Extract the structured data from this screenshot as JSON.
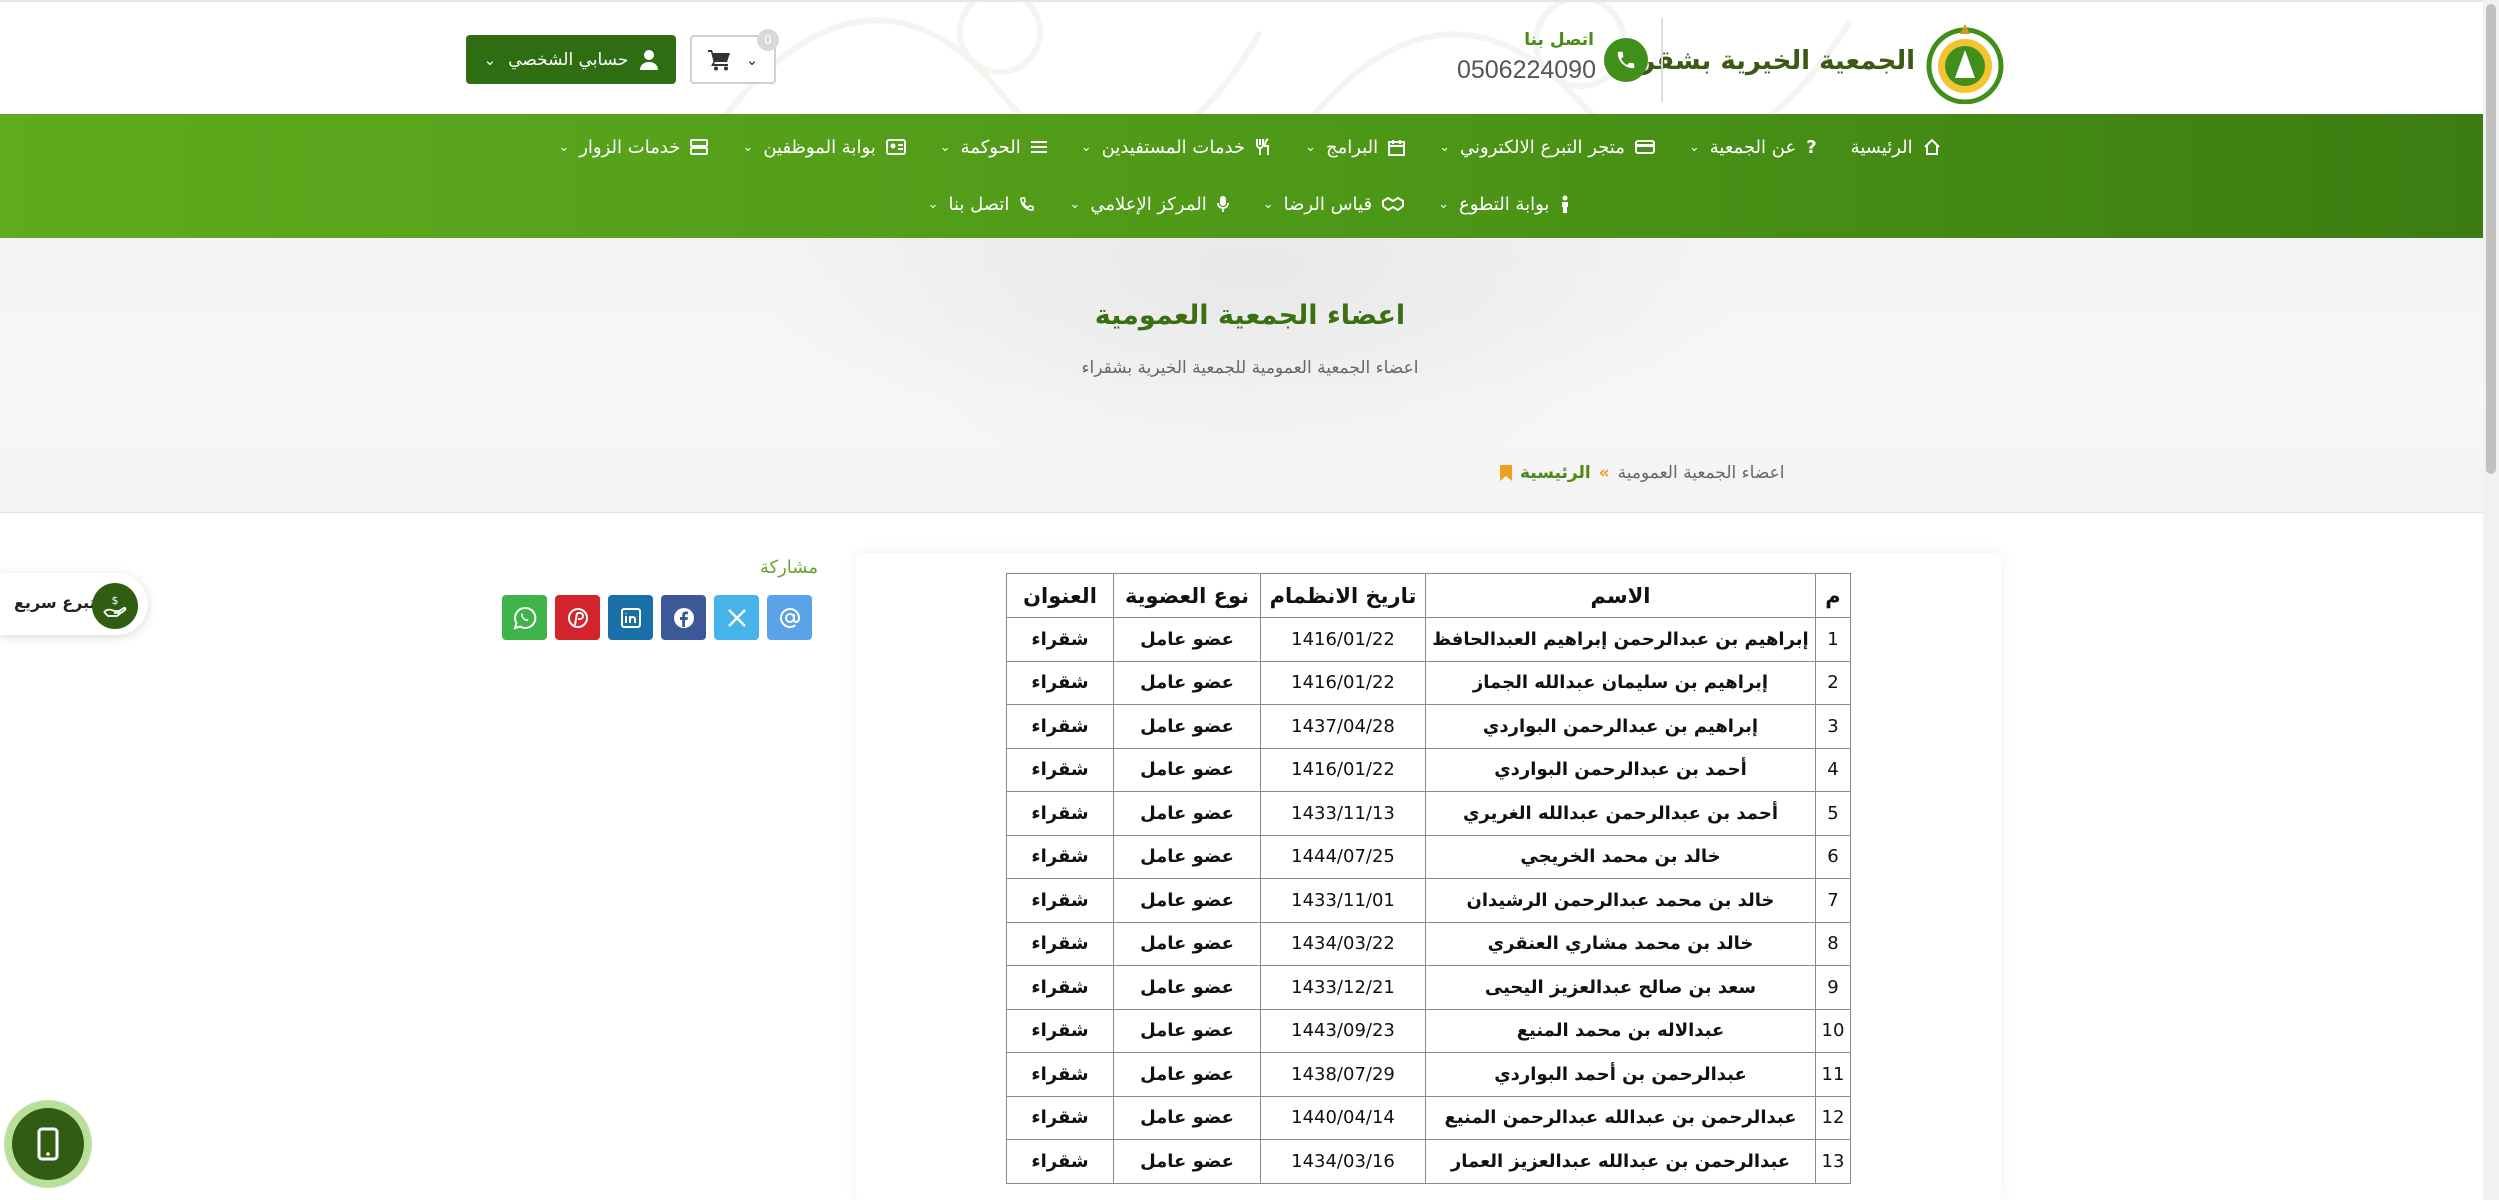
{
  "header": {
    "org_name": "الجمعية الخيرية بشقراء",
    "contact_label": "اتصل بنا",
    "contact_phone": "0506224090",
    "account_label": "حسابي الشخصي",
    "cart_count": "0"
  },
  "nav": {
    "row1": [
      {
        "label": "الرئيسية",
        "icon": "home-icon",
        "has_menu": false
      },
      {
        "label": "عن الجمعية",
        "icon": "question-icon",
        "has_menu": true
      },
      {
        "label": "متجر التبرع الالكتروني",
        "icon": "credit-card-icon",
        "has_menu": true
      },
      {
        "label": "البرامج",
        "icon": "calendar-icon",
        "has_menu": true
      },
      {
        "label": "خدمات المستفيدين",
        "icon": "utensils-icon",
        "has_menu": true
      },
      {
        "label": "الحوكمة",
        "icon": "list-icon",
        "has_menu": true
      },
      {
        "label": "بوابة الموظفين",
        "icon": "id-card-icon",
        "has_menu": true
      },
      {
        "label": "خدمات الزوار",
        "icon": "server-icon",
        "has_menu": true
      }
    ],
    "row2": [
      {
        "label": "بوابة التطوع",
        "icon": "person-icon",
        "has_menu": true
      },
      {
        "label": "قياس الرضا",
        "icon": "handshake-icon",
        "has_menu": true
      },
      {
        "label": "المركز الإعلامي",
        "icon": "microphone-icon",
        "has_menu": true
      },
      {
        "label": "اتصل بنا",
        "icon": "phone-icon",
        "has_menu": true
      }
    ]
  },
  "page": {
    "title": "اعضاء الجمعية العمومية",
    "subtitle": "اعضاء الجمعية العمومية للجمعية الخيرية بشقراء"
  },
  "breadcrumb": {
    "home": "الرئيسية",
    "separator": "»",
    "current": "اعضاء الجمعية العمومية"
  },
  "table": {
    "headers": [
      "م",
      "الاسم",
      "تاريخ الانظمام",
      "نوع العضوية",
      "العنوان"
    ],
    "rows": [
      [
        "1",
        "إبراهيم بن عبدالرحمن إبراهيم العبدالحافظ",
        "1416/01/22",
        "عضو عامل",
        "شقراء"
      ],
      [
        "2",
        "إبراهيم بن سليمان عبدالله الجماز",
        "1416/01/22",
        "عضو عامل",
        "شقراء"
      ],
      [
        "3",
        "إبراهيم بن عبدالرحمن البواردي",
        "1437/04/28",
        "عضو عامل",
        "شقراء"
      ],
      [
        "4",
        "أحمد بن عبدالرحمن البواردي",
        "1416/01/22",
        "عضو عامل",
        "شقراء"
      ],
      [
        "5",
        "أحمد بن عبدالرحمن عبدالله الغريري",
        "1433/11/13",
        "عضو عامل",
        "شقراء"
      ],
      [
        "6",
        "خالد بن محمد الخريجي",
        "1444/07/25",
        "عضو عامل",
        "شقراء"
      ],
      [
        "7",
        "خالد بن محمد عبدالرحمن الرشيدان",
        "1433/11/01",
        "عضو عامل",
        "شقراء"
      ],
      [
        "8",
        "خالد بن محمد مشاري العنقري",
        "1434/03/22",
        "عضو عامل",
        "شقراء"
      ],
      [
        "9",
        "سعد بن صالح عبدالعزيز اليحيى",
        "1433/12/21",
        "عضو عامل",
        "شقراء"
      ],
      [
        "10",
        "عبدالاله بن محمد المنيع",
        "1443/09/23",
        "عضو عامل",
        "شقراء"
      ],
      [
        "11",
        "عبدالرحمن بن أحمد البواردي",
        "1438/07/29",
        "عضو عامل",
        "شقراء"
      ],
      [
        "12",
        "عبدالرحمن بن عبدالله عبدالرحمن المنيع",
        "1440/04/14",
        "عضو عامل",
        "شقراء"
      ],
      [
        "13",
        "عبدالرحمن بن عبدالله عبدالعزيز العمار",
        "1434/03/16",
        "عضو عامل",
        "شقراء"
      ]
    ]
  },
  "share": {
    "label": "مشاركة",
    "buttons": [
      {
        "icon": "email-icon",
        "color": "#5aa3e8"
      },
      {
        "icon": "x-twitter-icon",
        "color": "#46b4e8"
      },
      {
        "icon": "facebook-icon",
        "color": "#3b5998"
      },
      {
        "icon": "linkedin-icon",
        "color": "#1b6fa8"
      },
      {
        "icon": "pinterest-icon",
        "color": "#d3242b"
      },
      {
        "icon": "whatsapp-icon",
        "color": "#3fb44a"
      }
    ]
  },
  "quick_donate": {
    "label": "تبرع سريع"
  },
  "colors": {
    "brand_green": "#4d9717",
    "dark_green": "#2f6d12",
    "title_green": "#3c6f14",
    "accent_orange": "#f0a020"
  }
}
